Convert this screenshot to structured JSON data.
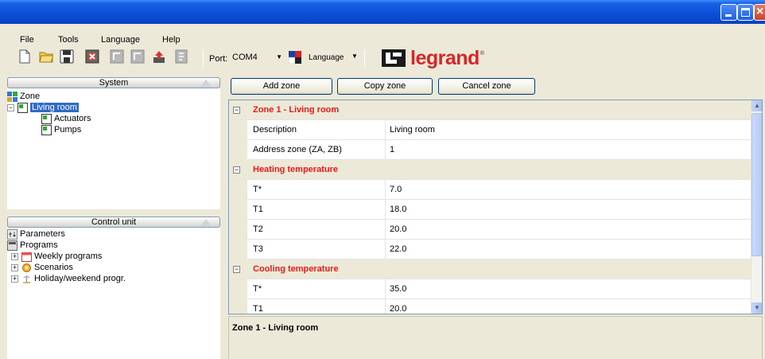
{
  "window": {
    "title": ""
  },
  "menu": [
    "File",
    "Tools",
    "Language",
    "Help"
  ],
  "toolbar": {
    "icons": [
      "new-icon",
      "open-icon",
      "save-icon",
      "close-file-icon",
      "receive-icon",
      "send-icon",
      "upload-icon",
      "export-icon"
    ],
    "port_label": "Port:",
    "port_value": "COM4",
    "language_label": "Language",
    "logo_text": "legrand",
    "logo_reg": "®"
  },
  "system_panel": {
    "header": "System",
    "items": [
      {
        "label": "Zone",
        "icon": "zone-icon",
        "level": 0
      },
      {
        "label": "Living room",
        "icon": "room-icon",
        "level": 1,
        "selected": true,
        "expander": "−"
      },
      {
        "label": "Actuators",
        "icon": "room-icon",
        "level": 2
      },
      {
        "label": "Pumps",
        "icon": "room-icon",
        "level": 2
      }
    ]
  },
  "control_panel": {
    "header": "Control unit",
    "items": [
      {
        "label": "Parameters",
        "icon": "parameters-icon",
        "level": 0
      },
      {
        "label": "Programs",
        "icon": "programs-icon",
        "level": 0
      },
      {
        "label": "Weekly programs",
        "icon": "calendar-icon",
        "level": 1,
        "expander": "+"
      },
      {
        "label": "Scenarios",
        "icon": "scenario-icon",
        "level": 1,
        "expander": "+"
      },
      {
        "label": "Holiday/weekend progr.",
        "icon": "holiday-icon",
        "level": 1,
        "expander": "+"
      }
    ]
  },
  "buttons": {
    "add": "Add zone",
    "copy": "Copy zone",
    "cancel": "Cancel zone"
  },
  "grid": {
    "rows": [
      {
        "type": "category",
        "title": "Zone 1 - Living room",
        "toggle": "−"
      },
      {
        "type": "prop",
        "name": "Description",
        "value": "Living room"
      },
      {
        "type": "prop",
        "name": "Address zone (ZA, ZB)",
        "value": "1"
      },
      {
        "type": "category",
        "title": "Heating temperature",
        "toggle": "−"
      },
      {
        "type": "prop",
        "name": "T*",
        "value": "7.0"
      },
      {
        "type": "prop",
        "name": "T1",
        "value": "18.0"
      },
      {
        "type": "prop",
        "name": "T2",
        "value": "20.0"
      },
      {
        "type": "prop",
        "name": "T3",
        "value": "22.0"
      },
      {
        "type": "category",
        "title": "Cooling temperature",
        "toggle": "−"
      },
      {
        "type": "prop",
        "name": "T*",
        "value": "35.0"
      },
      {
        "type": "prop",
        "name": "T1",
        "value": "20.0"
      }
    ]
  },
  "description_panel": {
    "title": "Zone 1 - Living room"
  },
  "colors": {
    "titlebar": "#0a4fd6",
    "category_text": "#e81a1a",
    "selection": "#316ac5",
    "logo": "#d6262a"
  }
}
